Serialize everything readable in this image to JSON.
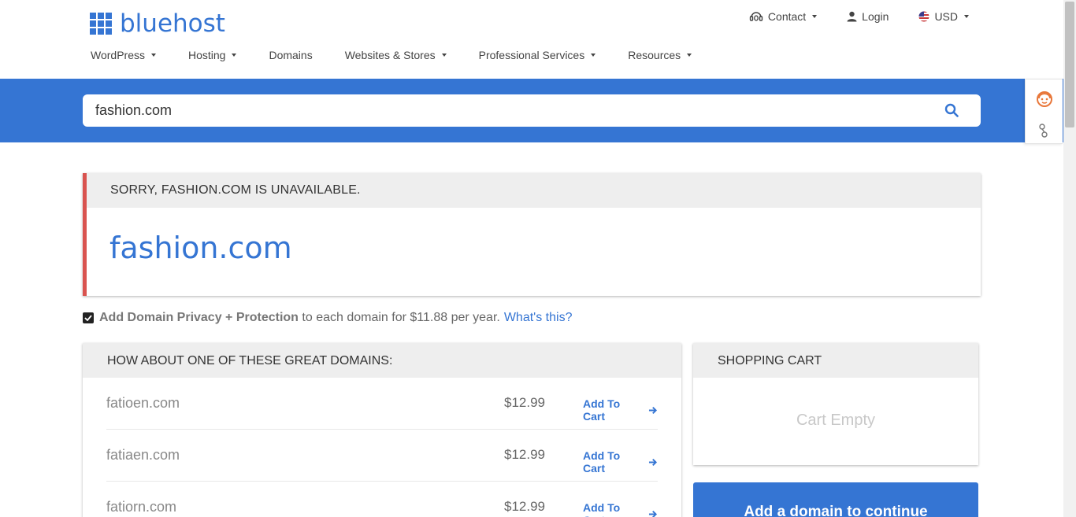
{
  "header": {
    "logo_text": "bluehost",
    "contact_label": "Contact",
    "login_label": "Login",
    "currency_label": "USD",
    "nav": [
      {
        "label": "WordPress",
        "dropdown": true
      },
      {
        "label": "Hosting",
        "dropdown": true
      },
      {
        "label": "Domains",
        "dropdown": false
      },
      {
        "label": "Websites & Stores",
        "dropdown": true
      },
      {
        "label": "Professional Services",
        "dropdown": true
      },
      {
        "label": "Resources",
        "dropdown": true
      }
    ]
  },
  "search": {
    "value": "fashion.com",
    "icon": "search-icon"
  },
  "result": {
    "status_heading": "SORRY, FASHION.COM IS UNAVAILABLE.",
    "domain": "fashion.com"
  },
  "privacy": {
    "checked": true,
    "bold_text": "Add Domain Privacy + Protection",
    "rest_text": "to each domain for $11.88 per year.",
    "link_text": "What's this?"
  },
  "suggestions": {
    "heading": "HOW ABOUT ONE OF THESE GREAT DOMAINS:",
    "items": [
      {
        "name": "fatioen.com",
        "price": "$12.99",
        "action": "Add To Cart"
      },
      {
        "name": "fatiaen.com",
        "price": "$12.99",
        "action": "Add To Cart"
      },
      {
        "name": "fatiorn.com",
        "price": "$12.99",
        "action": "Add To Cart"
      }
    ]
  },
  "cart": {
    "heading": "SHOPPING CART",
    "empty_text": "Cart Empty",
    "continue_label": "Add a domain to continue"
  },
  "colors": {
    "brand_blue": "#3575d3",
    "error_red": "#d9534f",
    "helper_orange": "#e8773a"
  }
}
